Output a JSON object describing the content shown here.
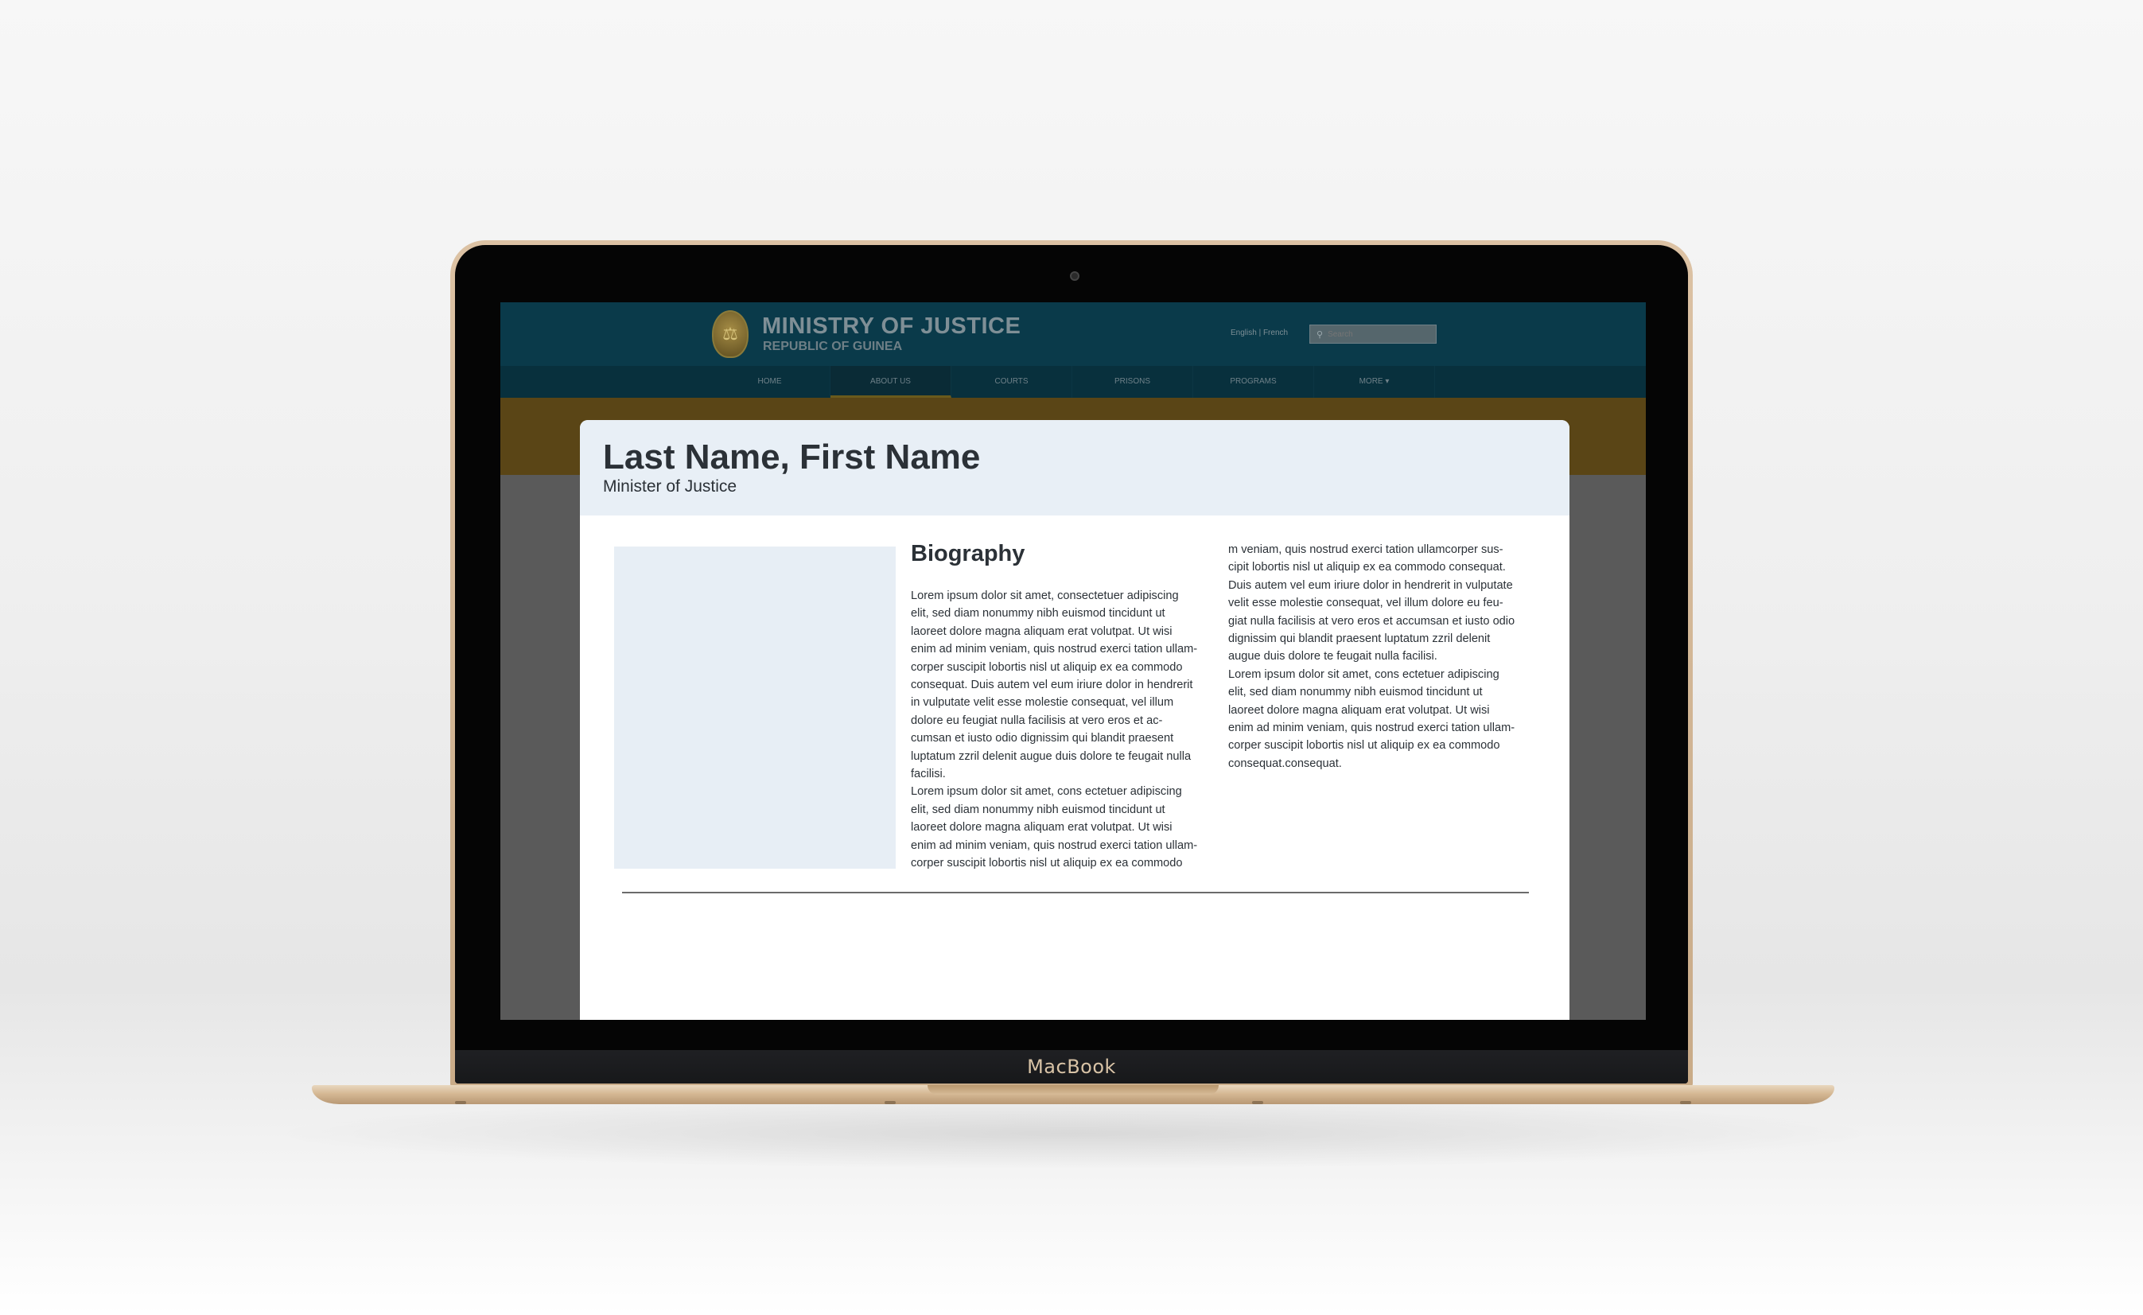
{
  "device": {
    "brand": "MacBook"
  },
  "site": {
    "title": "MINISTRY OF JUSTICE",
    "subtitle": "REPUBLIC OF GUINEA",
    "emblem_icon": "coat-of-arms",
    "language_switch": "English | French",
    "search_placeholder": "Search",
    "colors": {
      "header": "#0a3a4a",
      "nav": "#08303d",
      "band": "#5a4516"
    }
  },
  "nav": {
    "items": [
      {
        "label": "HOME"
      },
      {
        "label": "ABOUT US",
        "active": true
      },
      {
        "label": "COURTS"
      },
      {
        "label": "PRISONS"
      },
      {
        "label": "PROGRAMS"
      },
      {
        "label": "MORE ▾"
      }
    ]
  },
  "profile": {
    "name": "Last Name, First Name",
    "role": "Minister of Justice",
    "bio_heading": "Biography",
    "column1": [
      "Lorem ipsum dolor sit amet, consectetuer adipiscing",
      "elit, sed diam nonummy nibh euismod tincidunt ut",
      "laoreet dolore magna aliquam erat volutpat. Ut wisi",
      "enim ad minim veniam, quis nostrud exerci tation ullam-",
      "corper suscipit lobortis nisl ut aliquip ex ea commodo",
      "consequat. Duis autem vel eum iriure dolor in hendrerit",
      "in vulputate velit esse molestie consequat, vel illum",
      "dolore eu feugiat nulla facilisis at vero eros et ac-",
      "cumsan et iusto odio dignissim qui blandit praesent",
      "luptatum zzril delenit augue duis dolore te feugait nulla",
      "facilisi.",
      "Lorem ipsum dolor sit amet, cons ectetuer adipiscing",
      "elit, sed diam nonummy nibh euismod tincidunt ut",
      "laoreet dolore magna aliquam erat volutpat. Ut wisi",
      "enim ad minim veniam, quis nostrud exerci tation ullam-",
      "corper suscipit lobortis nisl ut aliquip ex ea commodo"
    ],
    "column2": [
      "m veniam, quis nostrud exerci tation ullamcorper sus-",
      "cipit lobortis nisl ut aliquip ex ea commodo consequat.",
      "Duis autem vel eum iriure dolor in hendrerit in vulputate",
      "velit esse molestie consequat, vel illum dolore eu feu-",
      "giat nulla facilisis at vero eros et accumsan et iusto odio",
      "dignissim qui blandit praesent luptatum zzril delenit",
      "augue duis dolore te feugait nulla facilisi.",
      "Lorem ipsum dolor sit amet, cons ectetuer adipiscing",
      "elit, sed diam nonummy nibh euismod tincidunt ut",
      "laoreet dolore magna aliquam erat volutpat. Ut wisi",
      "enim ad minim veniam, quis nostrud exerci tation ullam-",
      "corper suscipit lobortis nisl ut aliquip ex ea commodo",
      "consequat.consequat."
    ]
  }
}
